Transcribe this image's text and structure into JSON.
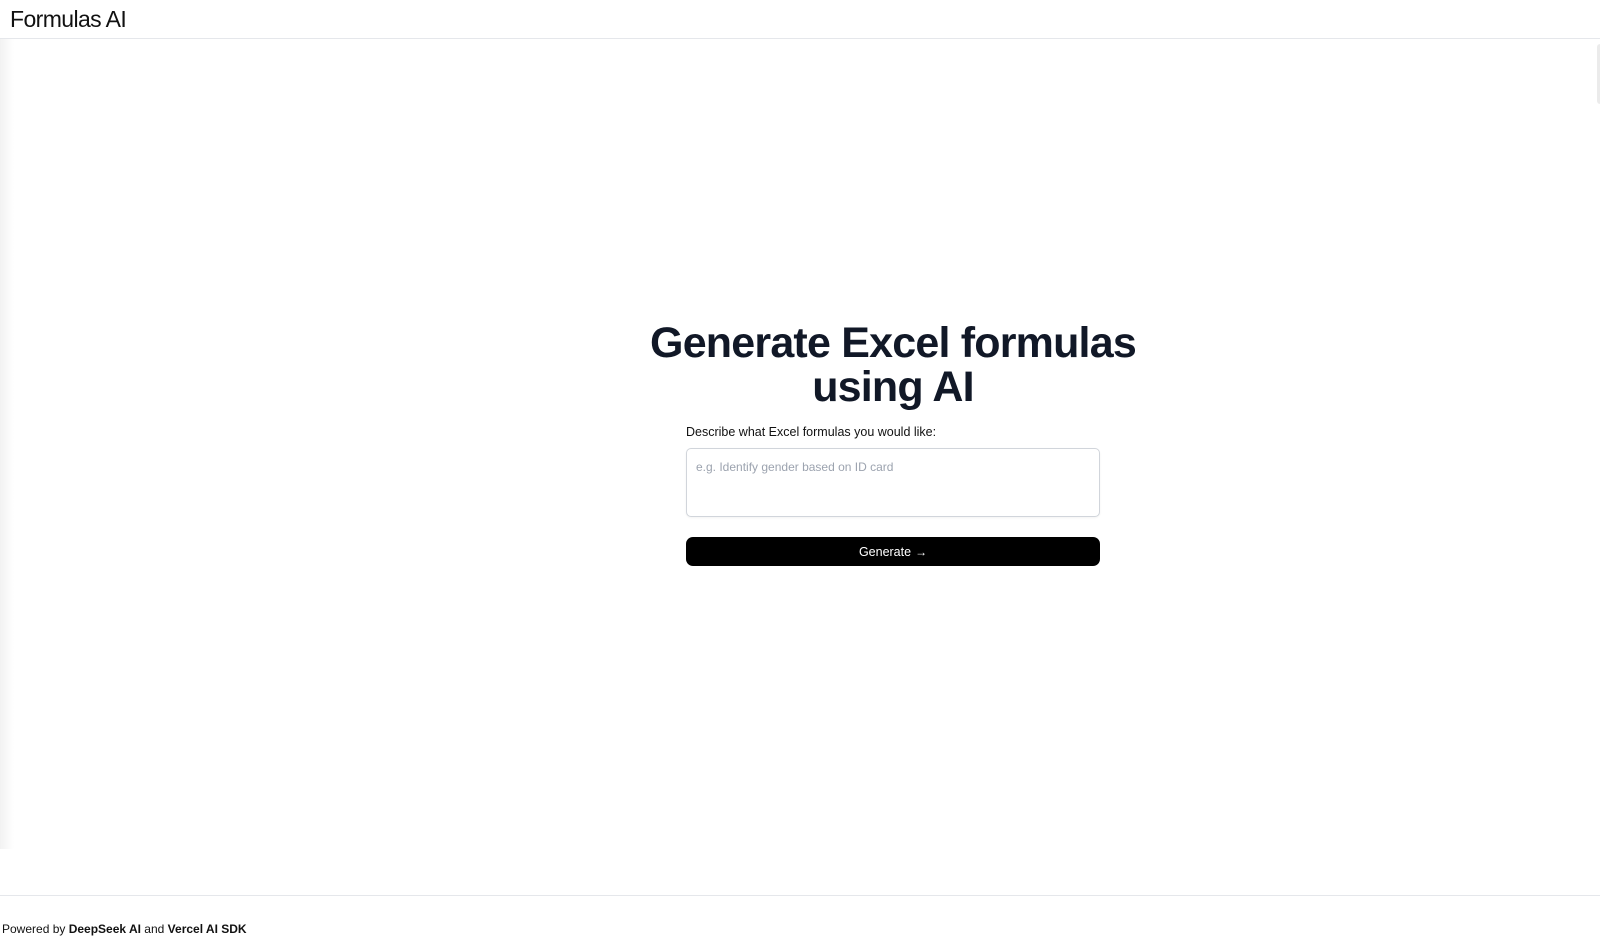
{
  "header": {
    "brand": "Formulas AI"
  },
  "hero": {
    "title": "Generate Excel formulas using AI"
  },
  "form": {
    "label": "Describe what Excel formulas you would like:",
    "input_value": "",
    "input_placeholder": "e.g. Identify gender based on ID card",
    "button_label": "Generate",
    "button_icon": "arrow-right-icon",
    "button_glyph": "→"
  },
  "footer": {
    "prefix": "Powered by ",
    "link1": "DeepSeek AI",
    "conjunction": " and ",
    "link2": "Vercel AI SDK"
  },
  "colors": {
    "button_bg": "#000000",
    "title_color": "#111827",
    "border": "#e5e7eb"
  }
}
